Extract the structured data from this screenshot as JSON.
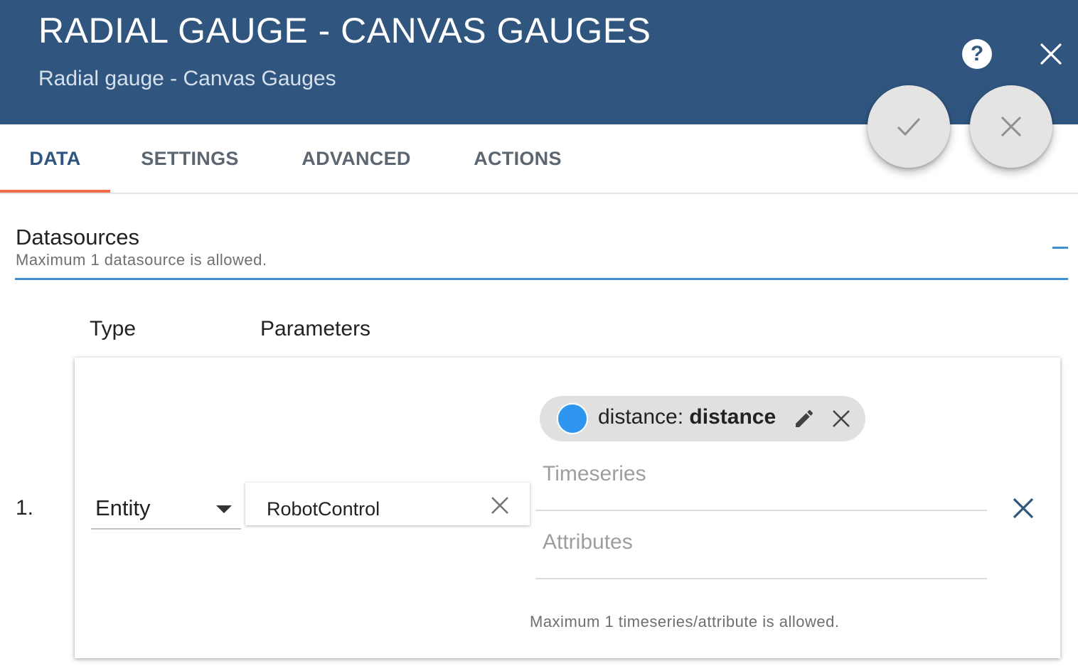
{
  "dialog": {
    "title": "RADIAL GAUGE - CANVAS GAUGES",
    "subtitle": "Radial gauge - Canvas Gauges",
    "help_icon": "?",
    "colors": {
      "header_bg": "#305680",
      "accent": "#3d8fd6",
      "tab_ink": "#ef6b45",
      "key_color": "#2f96ef"
    }
  },
  "tabs": [
    {
      "label": "DATA",
      "active": true
    },
    {
      "label": "SETTINGS",
      "active": false
    },
    {
      "label": "ADVANCED",
      "active": false
    },
    {
      "label": "ACTIONS",
      "active": false
    }
  ],
  "datasources": {
    "title": "Datasources",
    "hint": "Maximum 1 datasource is allowed.",
    "col_type": "Type",
    "col_params": "Parameters",
    "rows": [
      {
        "index": "1.",
        "type": "Entity",
        "entity": "RobotControl",
        "key": {
          "label": "distance",
          "name": "distance",
          "separator": ": ",
          "color": "#2f96ef"
        },
        "timeseries_placeholder": "Timeseries",
        "attributes_placeholder": "Attributes",
        "keys_hint": "Maximum 1 timeseries/attribute is allowed."
      }
    ]
  }
}
